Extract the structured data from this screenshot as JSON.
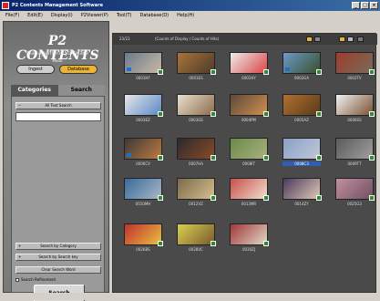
{
  "window": {
    "title": "P2 Contents Management Software",
    "controls": [
      "_",
      "□",
      "×"
    ]
  },
  "menu": [
    "File(F)",
    "Edit(E)",
    "Display(I)",
    "P2Viewer(P)",
    "Tool(T)",
    "Database(D)",
    "Help(H)"
  ],
  "left_panel": {
    "logo": "P2 CONTENTS",
    "logo_sub": "Management Software",
    "mode_label": "Mode",
    "mode_ingest": "Ingest",
    "mode_database": "Database",
    "tab_categories": "Categories",
    "tab_search": "Search",
    "all_text_search": "All Text Search",
    "search_category": "Search by Category",
    "search_keyword": "Search by Search key",
    "clear_search": "Clear Search Word",
    "search_refinement": "Search Refinement",
    "search_button": "Search"
  },
  "right_panel": {
    "count": "23/23",
    "count_note": "(Counts of Display / Counts of Hits)"
  },
  "clips": [
    {
      "name": "0001HF"
    },
    {
      "name": "0001ES"
    },
    {
      "name": "0001HY"
    },
    {
      "name": "0002GA"
    },
    {
      "name": "0002TV"
    },
    {
      "name": "0003EZ"
    },
    {
      "name": "0003GE"
    },
    {
      "name": "0004PM"
    },
    {
      "name": "0005AZ"
    },
    {
      "name": "0006SS"
    },
    {
      "name": "0006CV"
    },
    {
      "name": "0007HA"
    },
    {
      "name": "0008IT"
    },
    {
      "name": "0008C3"
    },
    {
      "name": "0009TT"
    },
    {
      "name": "0010MH"
    },
    {
      "name": "0012VZ"
    },
    {
      "name": "0013MR"
    },
    {
      "name": "0014ZY"
    },
    {
      "name": "0025G3"
    },
    {
      "name": "0026BS"
    },
    {
      "name": "0028VC"
    },
    {
      "name": "0030ZJ"
    }
  ],
  "colors": {
    "accent_selected": "#2e5fb5",
    "database_mode": "#e8b43a",
    "bg_dark": "#4a4a4a"
  }
}
